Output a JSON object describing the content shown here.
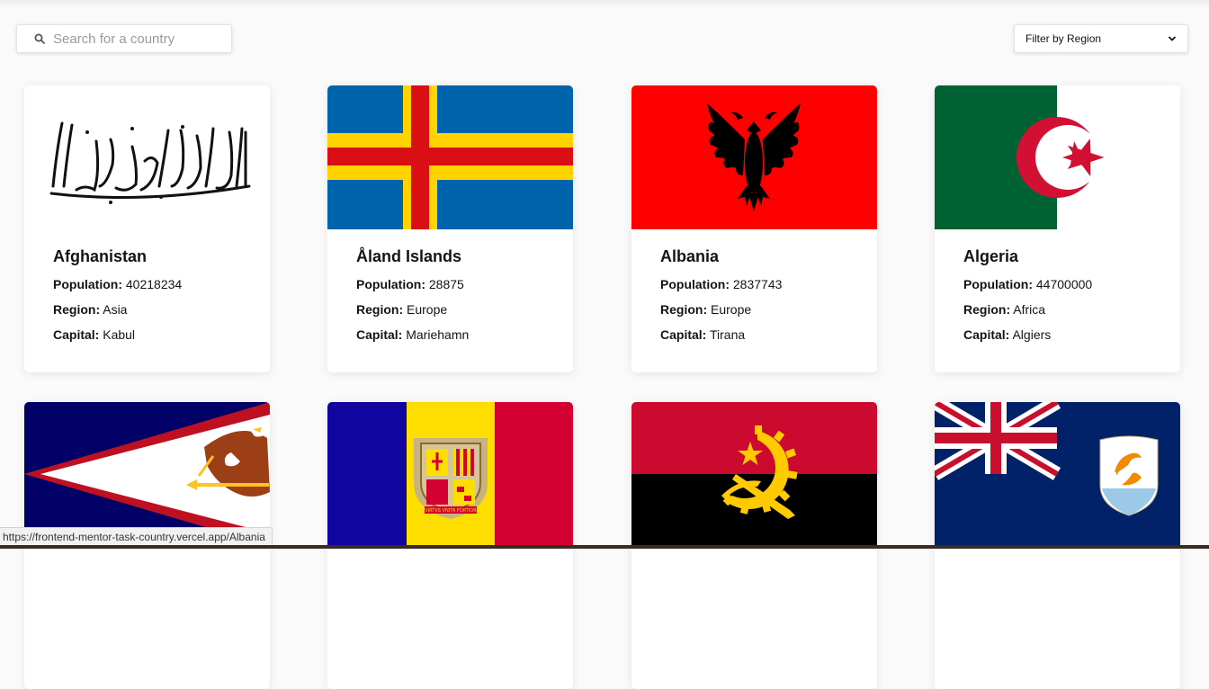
{
  "search": {
    "placeholder": "Search for a country",
    "icon": "search-icon"
  },
  "filter": {
    "label": "Filter by Region",
    "icon": "chevron-down-icon"
  },
  "field_labels": {
    "population": "Population:",
    "region": "Region:",
    "capital": "Capital:"
  },
  "countries": [
    {
      "name": "Afghanistan",
      "population": "40218234",
      "region": "Asia",
      "capital": "Kabul"
    },
    {
      "name": "Åland Islands",
      "population": "28875",
      "region": "Europe",
      "capital": "Mariehamn"
    },
    {
      "name": "Albania",
      "population": "2837743",
      "region": "Europe",
      "capital": "Tirana"
    },
    {
      "name": "Algeria",
      "population": "44700000",
      "region": "Africa",
      "capital": "Algiers"
    },
    {
      "name": "",
      "population": "",
      "region": "",
      "capital": ""
    },
    {
      "name": "",
      "population": "",
      "region": "",
      "capital": ""
    },
    {
      "name": "",
      "population": "",
      "region": "",
      "capital": ""
    },
    {
      "name": "",
      "population": "",
      "region": "",
      "capital": ""
    }
  ],
  "status_bar": {
    "url": "https://frontend-mentor-task-country.vercel.app/Albania"
  },
  "colors": {
    "background": "#fafafa",
    "card": "#ffffff",
    "text": "#111517"
  }
}
